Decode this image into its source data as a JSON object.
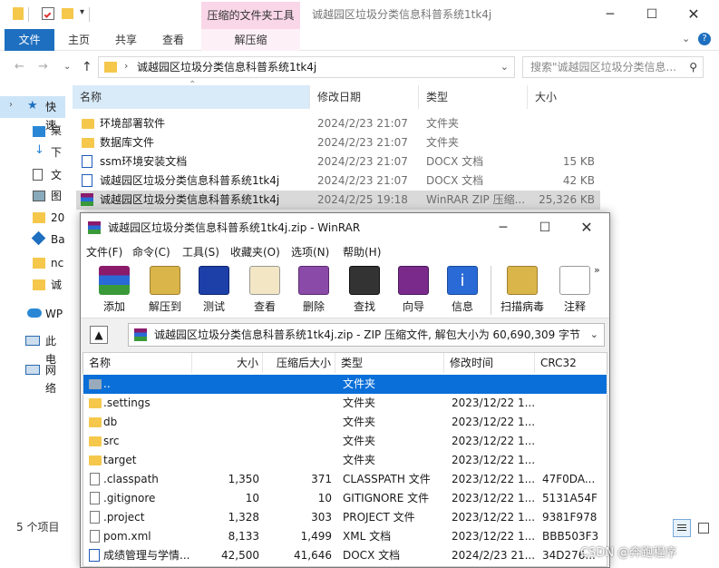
{
  "explorer": {
    "ctx_tab": "压缩的文件夹工具",
    "title": "诚越园区垃圾分类信息科普系统1tk4j",
    "ribbon_tabs": [
      "文件",
      "主页",
      "共享",
      "查看",
      "解压缩"
    ],
    "path": "诚越园区垃圾分类信息科普系统1tk4j",
    "search_placeholder": "搜索\"诚越园区垃圾分类信息...",
    "sidebar": [
      "快速",
      "桌",
      "下",
      "文",
      "图",
      "20",
      "Ba",
      "nc",
      "诚",
      "WP",
      "此电",
      "网络"
    ],
    "columns": [
      "名称",
      "修改日期",
      "类型",
      "大小"
    ],
    "files": [
      {
        "name": "环境部署软件",
        "date": "2024/2/23 21:07",
        "type": "文件夹",
        "size": "",
        "icon": "folder"
      },
      {
        "name": "数据库文件",
        "date": "2024/2/23 21:07",
        "type": "文件夹",
        "size": "",
        "icon": "folder"
      },
      {
        "name": "ssm环境安装文档",
        "date": "2024/2/23 21:07",
        "type": "DOCX 文档",
        "size": "15 KB",
        "icon": "docx"
      },
      {
        "name": "诚越园区垃圾分类信息科普系统1tk4j",
        "date": "2024/2/23 21:07",
        "type": "DOCX 文档",
        "size": "42 KB",
        "icon": "docx"
      },
      {
        "name": "诚越园区垃圾分类信息科普系统1tk4j",
        "date": "2024/2/25 19:18",
        "type": "WinRAR ZIP 压缩...",
        "size": "25,326 KB",
        "icon": "rar"
      }
    ],
    "status": "5 个项目"
  },
  "winrar": {
    "title": "诚越园区垃圾分类信息科普系统1tk4j.zip - WinRAR",
    "menu": [
      "文件(F)",
      "命令(C)",
      "工具(S)",
      "收藏夹(O)",
      "选项(N)",
      "帮助(H)"
    ],
    "tools": [
      "添加",
      "解压到",
      "测试",
      "查看",
      "删除",
      "查找",
      "向导",
      "信息",
      "扫描病毒",
      "注释"
    ],
    "path": "诚越园区垃圾分类信息科普系统1tk4j.zip - ZIP 压缩文件, 解包大小为 60,690,309 字节",
    "columns": [
      "名称",
      "大小",
      "压缩后大小",
      "类型",
      "修改时间",
      "CRC32"
    ],
    "rows": [
      {
        "name": "..",
        "size": "",
        "packed": "",
        "type": "文件夹",
        "mtime": "",
        "crc": "",
        "icon": "folder"
      },
      {
        "name": ".settings",
        "size": "",
        "packed": "",
        "type": "文件夹",
        "mtime": "2023/12/22 1...",
        "crc": "",
        "icon": "folder"
      },
      {
        "name": "db",
        "size": "",
        "packed": "",
        "type": "文件夹",
        "mtime": "2023/12/22 1...",
        "crc": "",
        "icon": "folder"
      },
      {
        "name": "src",
        "size": "",
        "packed": "",
        "type": "文件夹",
        "mtime": "2023/12/22 1...",
        "crc": "",
        "icon": "folder"
      },
      {
        "name": "target",
        "size": "",
        "packed": "",
        "type": "文件夹",
        "mtime": "2023/12/22 1...",
        "crc": "",
        "icon": "folder"
      },
      {
        "name": ".classpath",
        "size": "1,350",
        "packed": "371",
        "type": "CLASSPATH 文件",
        "mtime": "2023/12/22 1...",
        "crc": "47F0DA...",
        "icon": "file"
      },
      {
        "name": ".gitignore",
        "size": "10",
        "packed": "10",
        "type": "GITIGNORE 文件",
        "mtime": "2023/12/22 1...",
        "crc": "5131A54F",
        "icon": "file"
      },
      {
        "name": ".project",
        "size": "1,328",
        "packed": "303",
        "type": "PROJECT 文件",
        "mtime": "2023/12/22 1...",
        "crc": "9381F978",
        "icon": "file"
      },
      {
        "name": "pom.xml",
        "size": "8,133",
        "packed": "1,499",
        "type": "XML 文档",
        "mtime": "2023/12/22 1...",
        "crc": "BBB503F3",
        "icon": "file"
      },
      {
        "name": "成绩管理与学情...",
        "size": "42,500",
        "packed": "41,646",
        "type": "DOCX 文档",
        "mtime": "2024/2/23 21...",
        "crc": "34D276...",
        "icon": "docx"
      }
    ]
  },
  "watermark": "CSDN @奔跑程序"
}
